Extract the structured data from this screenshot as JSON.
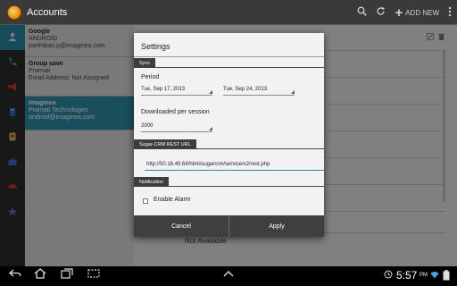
{
  "header": {
    "title": "Accounts",
    "add_new_label": "ADD NEW"
  },
  "accounts": [
    {
      "name": "Google",
      "lines": [
        "ANDROID",
        "parthiban.p@imaginea.com"
      ]
    },
    {
      "name": "Group save",
      "lines": [
        "Pramati",
        "Email Address: Not Assigned"
      ]
    },
    {
      "name": "Imaginea",
      "lines": [
        "Pramati Technologies",
        "android@imaginea.com"
      ]
    }
  ],
  "detail": {
    "not_available": "Not Available"
  },
  "dialog": {
    "title": "Settings",
    "sync_section": "Sync",
    "period_label": "Period",
    "period_from": "Tue, Sep 17, 2013",
    "period_to": "Tue, Sep 24, 2013",
    "downloaded_label": "Downloaded per session",
    "downloaded_value": "2000",
    "url_section": "Sugar-CRM REST URL",
    "url_value": "http://50.16.40.64/html/sugarcrm/service/v2/rest.php",
    "notification_section": "Notification",
    "enable_alarm_label": "Enable Alarm",
    "enable_alarm_checked": false,
    "cancel_label": "Cancel",
    "apply_label": "Apply"
  },
  "system_bar": {
    "time": "5:57",
    "ampm": "PM"
  },
  "colors": {
    "accent": "#2b8aa5",
    "selected_row": "#2f8fa9",
    "dialog_bg": "#f2f2f2"
  },
  "icons": [
    "app-logo-icon",
    "search-icon",
    "refresh-icon",
    "add-icon",
    "overflow-icon",
    "contacts-icon",
    "phone-icon",
    "megaphone-icon",
    "accounts-icon",
    "contact-card-icon",
    "briefcase-icon",
    "car-icon",
    "star-icon",
    "back-icon",
    "home-icon",
    "recents-icon",
    "up-chevron-icon",
    "wifi-icon",
    "battery-icon"
  ]
}
